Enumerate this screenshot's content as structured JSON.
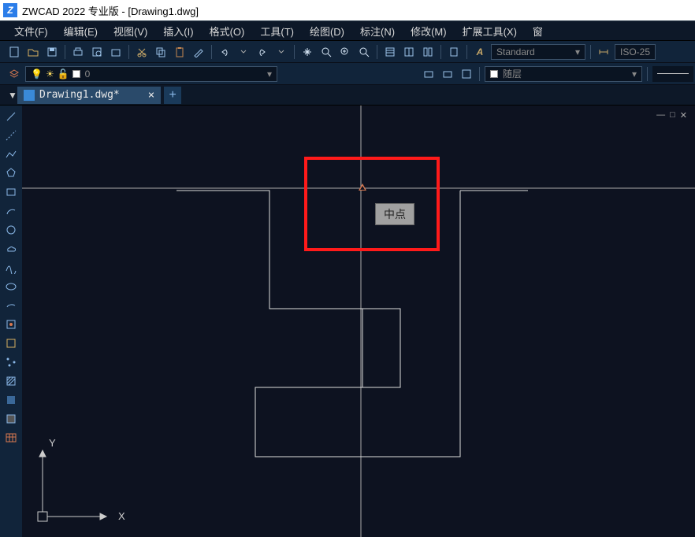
{
  "titlebar": {
    "app_icon_text": "Z",
    "title": "ZWCAD 2022 专业版 - [Drawing1.dwg]"
  },
  "menu": {
    "items": [
      "文件(F)",
      "编辑(E)",
      "视图(V)",
      "插入(I)",
      "格式(O)",
      "工具(T)",
      "绘图(D)",
      "标注(N)",
      "修改(M)",
      "扩展工具(X)",
      "窗"
    ]
  },
  "toolbar1": {
    "style_combo": "Standard",
    "dim_combo": "ISO-25"
  },
  "layerbar": {
    "layer_combo": "0",
    "color_combo": "随层"
  },
  "tab": {
    "filename": "Drawing1.dwg*"
  },
  "snap": {
    "tooltip": "中点"
  },
  "ucs": {
    "x": "X",
    "y": "Y"
  },
  "win_controls": {
    "min": "—",
    "max": "□",
    "close": "✕"
  },
  "colors": {
    "accent": "#2b7de9",
    "highlight": "#ff1a1a",
    "snap": "#d87850"
  }
}
